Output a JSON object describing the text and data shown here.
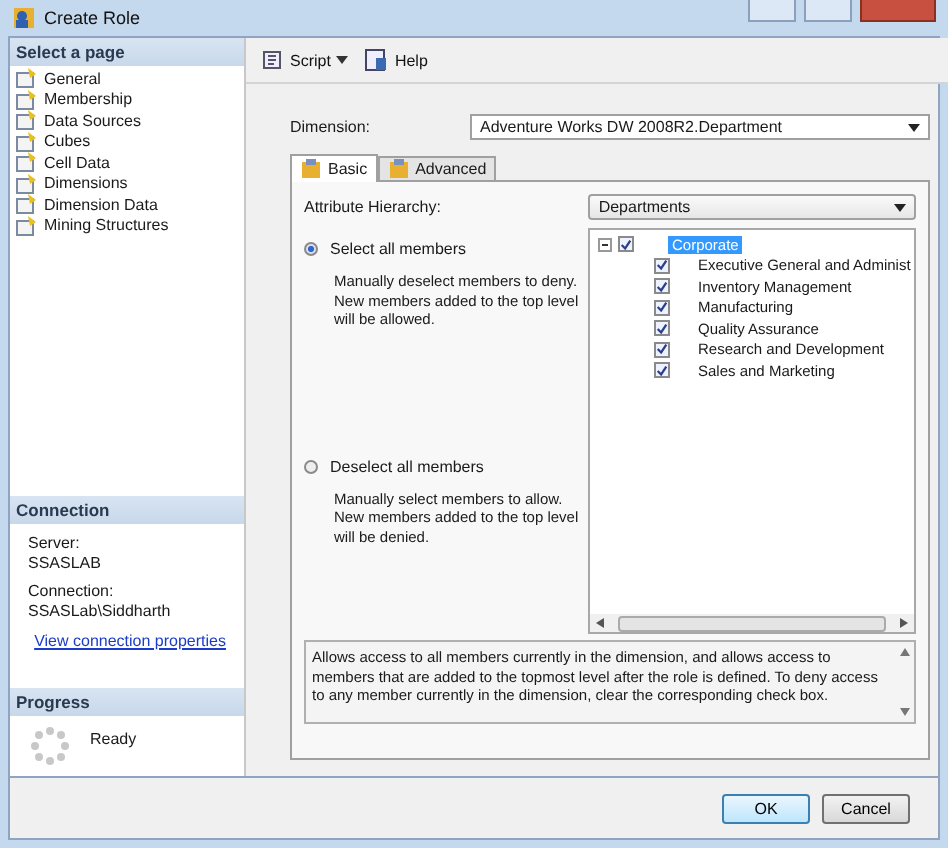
{
  "window": {
    "title": "Create Role"
  },
  "sidebar": {
    "heading": "Select a page",
    "pages": [
      {
        "label": "General"
      },
      {
        "label": "Membership"
      },
      {
        "label": "Data Sources"
      },
      {
        "label": "Cubes"
      },
      {
        "label": "Cell Data"
      },
      {
        "label": "Dimensions"
      },
      {
        "label": "Dimension Data"
      },
      {
        "label": "Mining Structures"
      }
    ]
  },
  "connection": {
    "heading": "Connection",
    "server_label": "Server:",
    "server": "SSASLAB",
    "connection_label": "Connection:",
    "connection": "SSASLab\\Siddharth",
    "link": "View connection properties"
  },
  "progress": {
    "heading": "Progress",
    "status": "Ready"
  },
  "toolbar": [
    {
      "label": "Script",
      "kind": "dropdown"
    },
    {
      "label": "Help",
      "kind": "button"
    }
  ],
  "dimension": {
    "label": "Dimension:",
    "value": "Adventure Works DW 2008R2.Department"
  },
  "tabs": [
    {
      "label": "Basic",
      "selected": true
    },
    {
      "label": "Advanced",
      "selected": false
    }
  ],
  "attribute_hierarchy": {
    "label": "Attribute Hierarchy:",
    "value": "Departments"
  },
  "options": [
    {
      "label": "Select all members",
      "selected": true,
      "description": "Manually deselect members to deny. New members added to the top level will be allowed."
    },
    {
      "label": "Deselect all members",
      "selected": false,
      "description": "Manually select members to allow. New members added to the top level will be denied."
    }
  ],
  "tree": [
    {
      "label": "Corporate",
      "checked": true,
      "expanded": true,
      "selected": true,
      "children": [
        {
          "label": "Executive General and Administ",
          "checked": true,
          "selected": false
        },
        {
          "label": "Inventory Management",
          "checked": true,
          "selected": false
        },
        {
          "label": "Manufacturing",
          "checked": true,
          "selected": false
        },
        {
          "label": "Quality Assurance",
          "checked": true,
          "selected": false
        },
        {
          "label": "Research and Development",
          "checked": true,
          "selected": false
        },
        {
          "label": "Sales and Marketing",
          "checked": true,
          "selected": false
        }
      ]
    }
  ],
  "description": "Allows access to all members currently in the dimension, and allows access to members that are added to the topmost level after the role is defined. To deny access to any member currently in the dimension, clear the corresponding check box.",
  "buttons": [
    "OK",
    "Cancel"
  ]
}
